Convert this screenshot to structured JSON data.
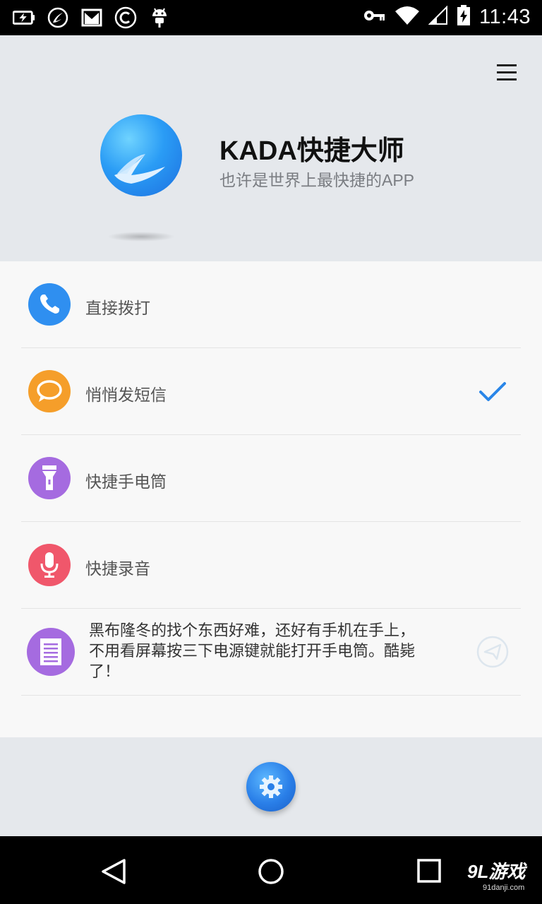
{
  "status_bar": {
    "time": "11:43",
    "icons_left": [
      "battery-charging-icon",
      "app-logo-icon",
      "gmail-icon",
      "copyright-icon",
      "android-icon"
    ],
    "icons_right": [
      "vpn-key-icon",
      "wifi-icon",
      "cell-signal-icon",
      "battery-icon"
    ]
  },
  "header": {
    "title": "KADA快捷大师",
    "subtitle": "也许是世界上最快捷的APP",
    "menu_icon": "hamburger-menu-icon"
  },
  "list": {
    "items": [
      {
        "label": "直接拨打",
        "icon": "phone-icon",
        "color": "#2f8ff0",
        "checked": false
      },
      {
        "label": "悄悄发短信",
        "icon": "message-icon",
        "color": "#f59e2a",
        "checked": true
      },
      {
        "label": "快捷手电筒",
        "icon": "flashlight-icon",
        "color": "#a56be0",
        "checked": false
      },
      {
        "label": "快捷录音",
        "icon": "microphone-icon",
        "color": "#f0576b",
        "checked": false
      }
    ],
    "quote": {
      "text": "黑布隆冬的找个东西好难，还好有手机在手上，不用看屏幕按三下电源键就能打开手电筒。酷毙了！",
      "icon": "document-icon",
      "action_icon": "send-icon"
    },
    "check_color": "#2a86e8"
  },
  "bottom": {
    "settings_icon": "gear-icon"
  },
  "nav_bar": {
    "buttons": [
      "back-icon",
      "home-icon",
      "recents-icon"
    ],
    "watermark": "9L游戏",
    "watermark_site": "91danji.com"
  }
}
